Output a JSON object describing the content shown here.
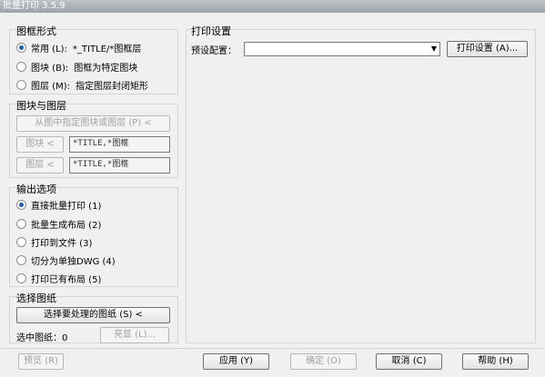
{
  "window": {
    "title": "批量打印 3.5.9"
  },
  "frame_type": {
    "title": "图框形式",
    "options": [
      {
        "label": "常用 (L):",
        "desc": "*_TITLE/*图框层",
        "selected": true
      },
      {
        "label": "图块 (B):",
        "desc": "图框为特定图块",
        "selected": false
      },
      {
        "label": "图层 (M):",
        "desc": "指定图层封闭矩形",
        "selected": false
      }
    ]
  },
  "block_layer": {
    "title": "图块与图层",
    "pick_button": "从图中指定图块或图层 (P) <",
    "block_button": "图块 <",
    "block_value": "*TITLE,*图框",
    "layer_button": "图层 <",
    "layer_value": "*TITLE,*图框"
  },
  "output": {
    "title": "输出选项",
    "options": [
      {
        "label": "直接批量打印 (1)",
        "selected": true
      },
      {
        "label": "批量生成布局 (2)",
        "selected": false
      },
      {
        "label": "打印到文件 (3)",
        "selected": false
      },
      {
        "label": "切分为单独DWG (4)",
        "selected": false
      },
      {
        "label": "打印已有布局 (5)",
        "selected": false
      }
    ]
  },
  "select_drawing": {
    "title": "选择图纸",
    "select_button": "选择要处理的图纸 (S) <",
    "selected_label": "选中图纸：0",
    "highlight_button": "亮显 (L)..."
  },
  "print_settings": {
    "title": "打印设置",
    "preset_label": "预设配置：",
    "preset_value": "",
    "settings_button": "打印设置 (A)..."
  },
  "footer": {
    "preview": "预览 (R)",
    "apply": "应用 (Y)",
    "ok": "确定 (O)",
    "cancel": "取消 (C)",
    "help": "帮助 (H)"
  }
}
